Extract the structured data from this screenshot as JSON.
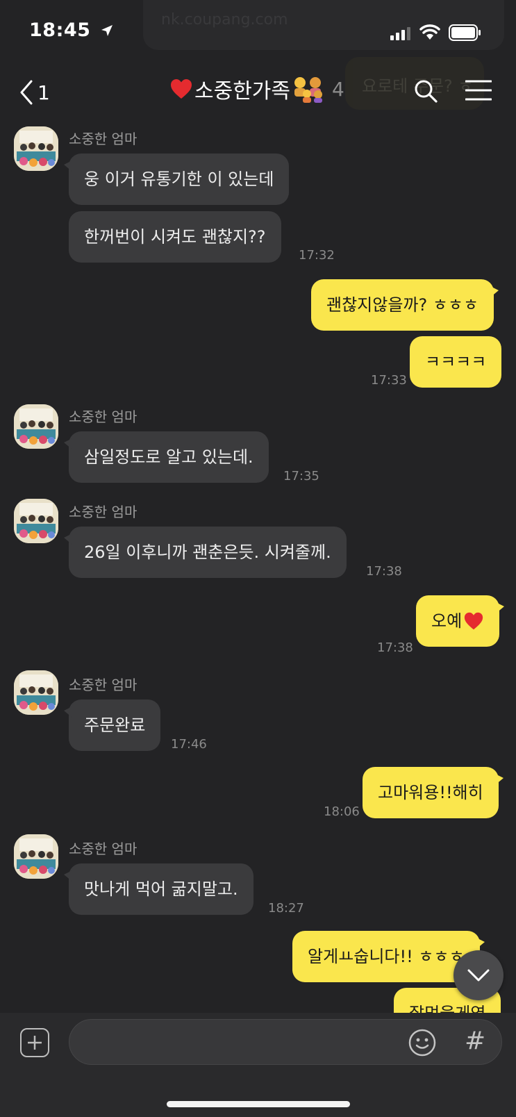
{
  "status": {
    "time": "18:45"
  },
  "ghost": {
    "top_text": "nk.coupang.com",
    "search_text": "요로테 주문? ㅎ"
  },
  "header": {
    "back_count": "1",
    "title": "소중한가족",
    "member_count": "4"
  },
  "messages": [
    {
      "sender": "소중한 엄마",
      "text": "웅 이거 유통기한 이 있는데"
    },
    {
      "text": "한꺼번이 시켜도 괜찮지??",
      "time": "17:32"
    },
    {
      "text": "괜찮지않을까? ㅎㅎㅎ"
    },
    {
      "text": "ㅋㅋㅋㅋ",
      "time": "17:33"
    },
    {
      "sender": "소중한 엄마",
      "text": "삼일정도로 알고 있는데.",
      "time": "17:35"
    },
    {
      "sender": "소중한 엄마",
      "text": "26일 이후니까 괜춘은듯. 시켜줄께.",
      "time": "17:38"
    },
    {
      "text": "오예",
      "time": "17:38"
    },
    {
      "sender": "소중한 엄마",
      "text": "주문완료",
      "time": "17:46"
    },
    {
      "text": "고마워용!!해히",
      "time": "18:06"
    },
    {
      "sender": "소중한 엄마",
      "text": "맛나게 먹어 굶지말고.",
      "time": "18:27"
    },
    {
      "text": "알게ㅛ숩니다!! ㅎㅎㅎ"
    },
    {
      "text": "잘먹을게염"
    }
  ],
  "input": {
    "placeholder": ""
  },
  "icons": {
    "back": "chevron-left-icon",
    "search": "search-icon",
    "menu": "hamburger-menu-icon",
    "plus": "plus-icon",
    "emoji": "smiley-icon",
    "hash": "#",
    "scroll": "chevron-down-icon"
  },
  "colors": {
    "background": "#232325",
    "incoming": "#3b3b3d",
    "outgoing": "#fae64d"
  }
}
